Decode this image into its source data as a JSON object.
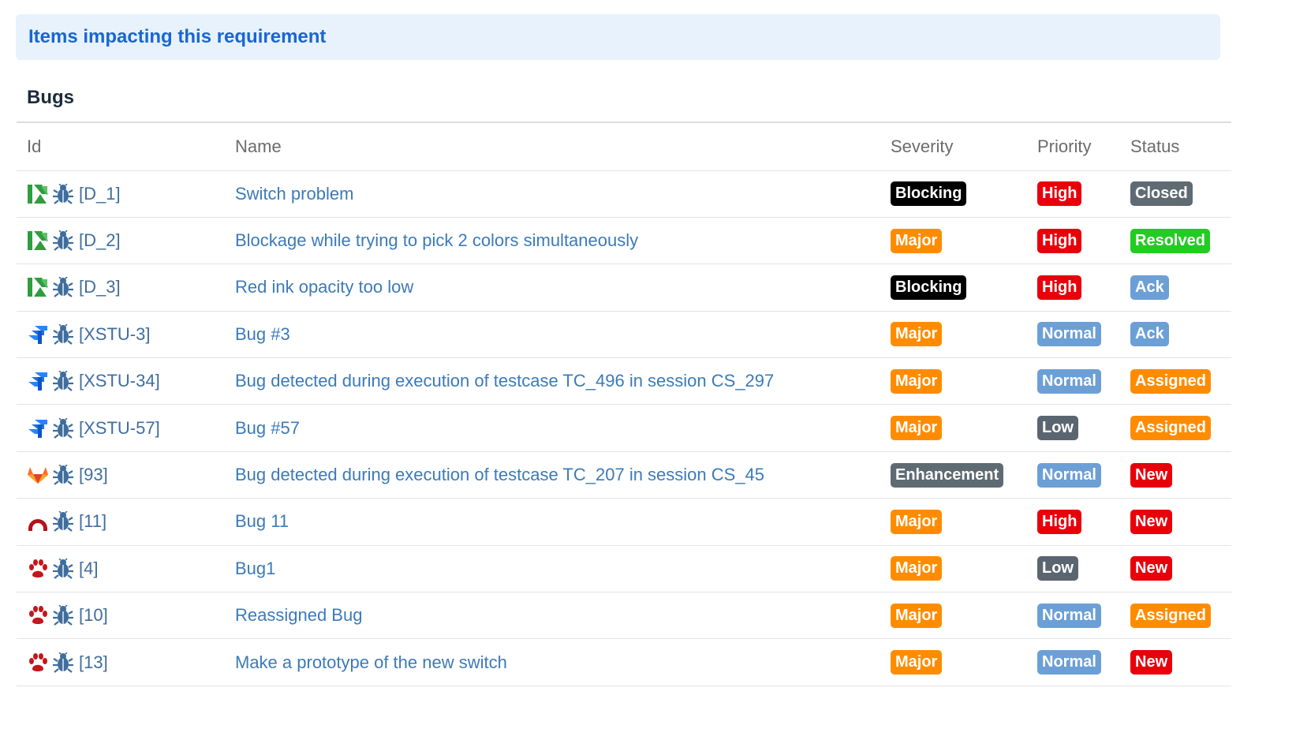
{
  "header": {
    "title": "Items impacting this requirement"
  },
  "section": {
    "title": "Bugs"
  },
  "table": {
    "columns": {
      "id": "Id",
      "name": "Name",
      "severity": "Severity",
      "priority": "Priority",
      "status": "Status"
    },
    "rows": [
      {
        "tracker_icon": "tracker-green-icon",
        "type_icon": "bug-icon",
        "id": "[D_1]",
        "name": "Switch problem",
        "severity": "Blocking",
        "priority": "High",
        "status": "Closed"
      },
      {
        "tracker_icon": "tracker-green-icon",
        "type_icon": "bug-icon",
        "id": "[D_2]",
        "name": "Blockage while trying to pick 2 colors simultaneously",
        "severity": "Major",
        "priority": "High",
        "status": "Resolved"
      },
      {
        "tracker_icon": "tracker-green-icon",
        "type_icon": "bug-icon",
        "id": "[D_3]",
        "name": "Red ink opacity too low",
        "severity": "Blocking",
        "priority": "High",
        "status": "Ack"
      },
      {
        "tracker_icon": "jira-icon",
        "type_icon": "bug-icon",
        "id": "[XSTU-3]",
        "name": "Bug #3",
        "severity": "Major",
        "priority": "Normal",
        "status": "Ack"
      },
      {
        "tracker_icon": "jira-icon",
        "type_icon": "bug-icon",
        "id": "[XSTU-34]",
        "name": "Bug detected during execution of testcase TC_496 in session CS_297",
        "severity": "Major",
        "priority": "Normal",
        "status": "Assigned"
      },
      {
        "tracker_icon": "jira-icon",
        "type_icon": "bug-icon",
        "id": "[XSTU-57]",
        "name": "Bug #57",
        "severity": "Major",
        "priority": "Low",
        "status": "Assigned"
      },
      {
        "tracker_icon": "gitlab-icon",
        "type_icon": "bug-icon",
        "id": "[93]",
        "name": "Bug detected during execution of testcase TC_207 in session CS_45",
        "severity": "Enhancement",
        "priority": "Normal",
        "status": "New"
      },
      {
        "tracker_icon": "redmine-icon",
        "type_icon": "bug-icon",
        "id": "[11]",
        "name": "Bug 11",
        "severity": "Major",
        "priority": "High",
        "status": "New"
      },
      {
        "tracker_icon": "paw-icon",
        "type_icon": "bug-icon",
        "id": "[4]",
        "name": "Bug1",
        "severity": "Major",
        "priority": "Low",
        "status": "New"
      },
      {
        "tracker_icon": "paw-icon",
        "type_icon": "bug-icon",
        "id": "[10]",
        "name": "Reassigned Bug",
        "severity": "Major",
        "priority": "Normal",
        "status": "Assigned"
      },
      {
        "tracker_icon": "paw-icon",
        "type_icon": "bug-icon",
        "id": "[13]",
        "name": "Make a prototype of the new switch",
        "severity": "Major",
        "priority": "Normal",
        "status": "New"
      }
    ]
  },
  "badge_colors": {
    "Blocking": "#000000",
    "Major": "#ff8c00",
    "Enhancement": "#5f6b73",
    "High": "#e8000b",
    "Normal": "#6c9fd6",
    "Low": "#5a6570",
    "Closed": "#5f6b73",
    "Resolved": "#22cc22",
    "Ack": "#6c9fd6",
    "Assigned": "#ff8c00",
    "New": "#e8000b"
  },
  "colors": {
    "banner_bg": "#e8f2fd",
    "banner_text": "#1a66d2",
    "link": "#3c7ab8"
  }
}
